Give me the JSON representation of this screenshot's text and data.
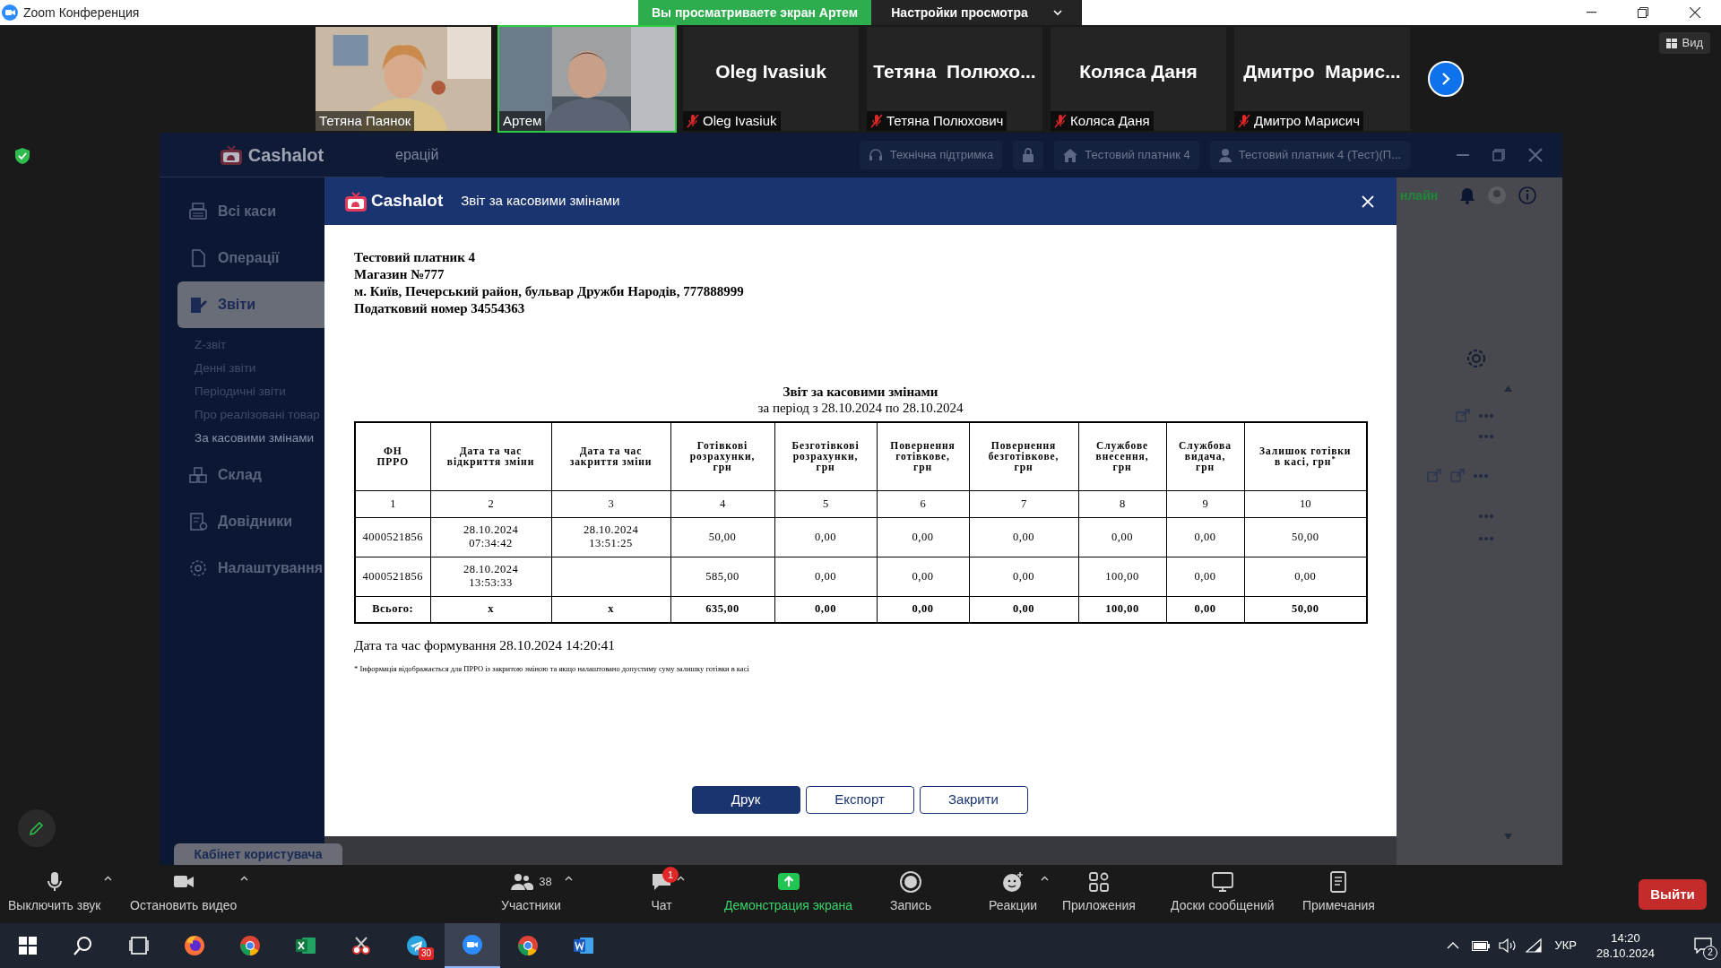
{
  "window": {
    "title": "Zoom Конференция"
  },
  "share_banner": {
    "status": "Вы просматриваете экран Артем",
    "menu": "Настройки просмотра"
  },
  "view_button": "Вид",
  "participants": [
    {
      "kind": "video",
      "name": "Тетяна Паянок",
      "muted": false,
      "speaking": false
    },
    {
      "kind": "video",
      "name": "Артем",
      "muted": false,
      "speaking": true
    },
    {
      "kind": "name",
      "display_name": "Oleg Ivasiuk",
      "name": "Oleg Ivasiuk",
      "muted": true,
      "speaking": false
    },
    {
      "kind": "name",
      "display_name": "Тетяна  Полюхо...",
      "name": "Тетяна Полюхович",
      "muted": true,
      "speaking": false
    },
    {
      "kind": "name",
      "display_name": "Коляса Даня",
      "name": "Коляса Даня",
      "muted": true,
      "speaking": false
    },
    {
      "kind": "name",
      "display_name": "Дмитро  Марис...",
      "name": "Дмитро Марисич",
      "muted": true,
      "speaking": false
    }
  ],
  "app": {
    "logo": "Cashalot",
    "page_title": "ерацій",
    "toolbar": [
      {
        "kind": "support",
        "label": "Технічна підтримка"
      },
      {
        "kind": "lock"
      },
      {
        "kind": "home",
        "label": "Тестовий платник 4"
      },
      {
        "kind": "user",
        "label": "Тестовий платник 4 (Тест)(П..."
      }
    ],
    "status": "нлайн",
    "sidebar": [
      {
        "kind": "register",
        "label": "Всі каси",
        "selected": false
      },
      {
        "kind": "doc",
        "label": "Операції",
        "selected": false
      },
      {
        "kind": "report",
        "label": "Звіти",
        "selected": true,
        "children": [
          {
            "label": "Z-звіт",
            "selected": false
          },
          {
            "label": "Денні звіти",
            "selected": false
          },
          {
            "label": "Періодичні звіти",
            "selected": false
          },
          {
            "label": "Про реалізовані товар",
            "selected": false
          },
          {
            "label": "За касовими змінами",
            "selected": true
          }
        ]
      },
      {
        "kind": "stock",
        "label": "Склад",
        "selected": false
      },
      {
        "kind": "book",
        "label": "Довідники",
        "selected": false
      },
      {
        "kind": "gear",
        "label": "Налаштування",
        "selected": false
      }
    ],
    "cabinet_button": "Кабінет користувача"
  },
  "dialog": {
    "logo": "Cashalot",
    "title": "Звіт за касовими змінами",
    "company": [
      "Тестовий платник 4",
      "Магазин №777",
      "м. Київ, Печерський район, бульвар Дружби Народів, 777888999",
      "Податковий номер 34554363"
    ],
    "report_title": "Звіт за касовими змінами",
    "period": "за період з 28.10.2024 по 28.10.2024",
    "table": {
      "columns": [
        "ФН ПРРО",
        "Дата та час відкриття зміни",
        "Дата та час закриття зміни",
        "Готівкові розрахунки, грн",
        "Безготівкові розрахунки, грн",
        "Повернення готівкове, грн",
        "Повернення безготівкове, грн",
        "Службове внесення, грн",
        "Службова видача, грн",
        "Залишок готівки в касі, грн$^{*}$"
      ],
      "column_numbers": [
        "1",
        "2",
        "3",
        "4",
        "5",
        "6",
        "7",
        "8",
        "9",
        "10"
      ],
      "rows": [
        {
          "kind": "data",
          "cells": [
            "4000521856",
            "28.10.2024\n07:34:42",
            "28.10.2024\n13:51:25",
            "50,00",
            "0,00",
            "0,00",
            "0,00",
            "0,00",
            "0,00",
            "50,00"
          ]
        },
        {
          "kind": "data",
          "cells": [
            "4000521856",
            "28.10.2024\n13:53:33",
            "",
            "585,00",
            "0,00",
            "0,00",
            "0,00",
            "100,00",
            "0,00",
            "0,00"
          ]
        },
        {
          "kind": "total",
          "cells": [
            "Всього:",
            "x",
            "x",
            "635,00",
            "0,00",
            "0,00",
            "0,00",
            "100,00",
            "0,00",
            "50,00"
          ]
        }
      ]
    },
    "generated": "Дата та час формування 28.10.2024 14:20:41",
    "footnote": "* Інформація відображається для ПРРО із закритою зміною та якщо налаштовано допустиму суму залишку готівки в касі",
    "buttons": [
      {
        "kind": "primary",
        "label": "Друк"
      },
      {
        "kind": "secondary",
        "label": "Експорт"
      },
      {
        "kind": "secondary",
        "label": "Закрити"
      }
    ]
  },
  "toolbar": [
    {
      "kind": "mic",
      "label": "Выключить звук",
      "has_menu": true
    },
    {
      "kind": "video",
      "label": "Остановить видео",
      "has_menu": true
    },
    {
      "kind": "participants",
      "label": "Участники",
      "count": "38",
      "has_menu": true
    },
    {
      "kind": "chat",
      "label": "Чат",
      "badge": "1",
      "has_menu": true
    },
    {
      "kind": "share",
      "label": "Демонстрация экрана",
      "has_menu": false
    },
    {
      "kind": "record",
      "label": "Запись",
      "has_menu": false
    },
    {
      "kind": "reactions",
      "label": "Реакции",
      "has_menu": true
    },
    {
      "kind": "apps",
      "label": "Приложения",
      "has_menu": false
    },
    {
      "kind": "whiteboards",
      "label": "Доски сообщений",
      "has_menu": false
    },
    {
      "kind": "notes",
      "label": "Примечания",
      "has_menu": false
    }
  ],
  "leave_button": "Выйти",
  "taskbar": {
    "apps": [
      {
        "kind": "start",
        "active": false
      },
      {
        "kind": "search",
        "active": false
      },
      {
        "kind": "taskview",
        "active": false
      },
      {
        "kind": "firefox",
        "active": false
      },
      {
        "kind": "chrome",
        "active": false
      },
      {
        "kind": "excel",
        "active": false
      },
      {
        "kind": "tool",
        "active": false
      },
      {
        "kind": "telegram",
        "active": false,
        "badge": "30"
      },
      {
        "kind": "zoom",
        "active": true
      },
      {
        "kind": "chrome",
        "active": false
      },
      {
        "kind": "word",
        "active": false
      }
    ],
    "language": "УКР",
    "time": "14:20",
    "date": "28.10.2024",
    "notifications": "2"
  }
}
